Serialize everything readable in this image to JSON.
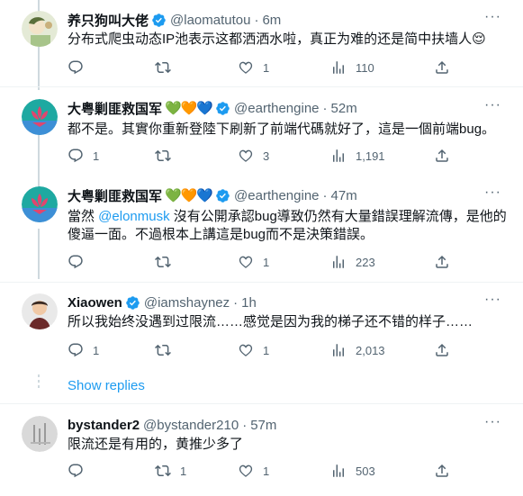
{
  "tweets": [
    {
      "name": "养只狗叫大佬",
      "hearts": "",
      "handle": "@laomatutou",
      "time": "6m",
      "text": "分布式爬虫动态IP池表示这都洒洒水啦，真正为难的还是简中扶墙人😌",
      "replies": "",
      "retweets": "",
      "likes": "1",
      "views": "110"
    },
    {
      "name": "大粤剿匪救国军",
      "hearts": "💚🧡💙",
      "handle": "@earthengine",
      "time": "52m",
      "text": "都不是。其實你重新登陸下刷新了前端代碼就好了，這是一個前端bug。",
      "replies": "1",
      "retweets": "",
      "likes": "3",
      "views": "1,191"
    },
    {
      "name": "大粤剿匪救国军",
      "hearts": "💚🧡💙",
      "handle": "@earthengine",
      "time": "47m",
      "text_prefix": "當然 ",
      "mention": "@elonmusk",
      "text_suffix": " 沒有公開承認bug導致仍然有大量錯誤理解流傳，是他的傻逼一面。不過根本上講這是bug而不是決策錯誤。",
      "replies": "",
      "retweets": "",
      "likes": "1",
      "views": "223"
    },
    {
      "name": "Xiaowen",
      "hearts": "",
      "handle": "@iamshaynez",
      "time": "1h",
      "text": "所以我始终没遇到过限流……感觉是因为我的梯子还不错的样子……",
      "replies": "1",
      "retweets": "",
      "likes": "1",
      "views": "2,013"
    },
    {
      "name": "bystander2",
      "hearts": "",
      "handle": "@bystander210",
      "time": "57m",
      "text": "限流还是有用的，黄推少多了",
      "replies": "",
      "retweets": "1",
      "likes": "1",
      "views": "503"
    }
  ],
  "show_replies": "Show replies",
  "separator": "·",
  "more": "···",
  "colors": {
    "accent": "#1d9bf0",
    "muted": "#536471",
    "text": "#0f1419",
    "divider": "#eff3f4"
  }
}
